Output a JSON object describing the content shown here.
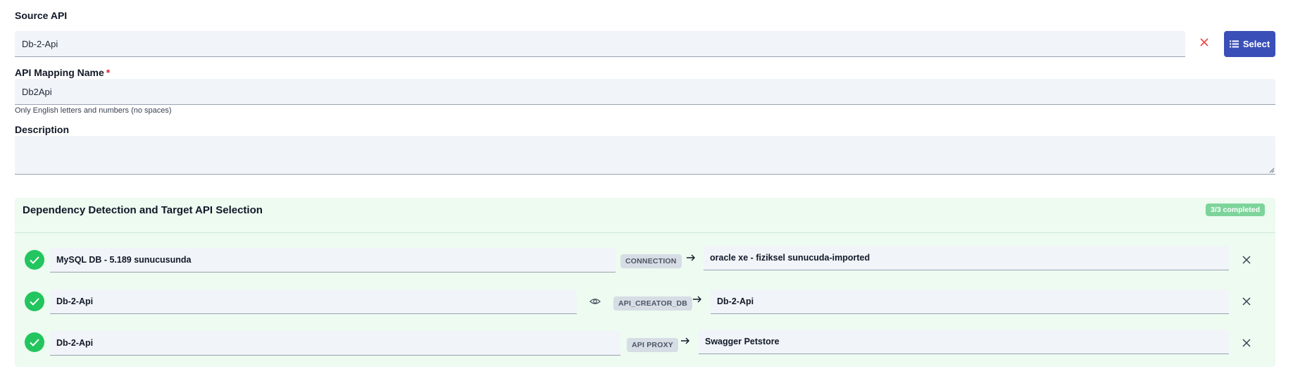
{
  "source_api": {
    "label": "Source API",
    "value": "Db-2-Api",
    "select_label": "Select"
  },
  "mapping_name": {
    "label": "API Mapping Name",
    "required_mark": "*",
    "value": "Db2Api",
    "hint": "Only English letters and numbers (no spaces)"
  },
  "description": {
    "label": "Description",
    "value": ""
  },
  "dependencies": {
    "title": "Dependency Detection and Target API Selection",
    "status_badge": "3/3 completed",
    "rows": [
      {
        "source": "MySQL DB - 5.189 sunucusunda",
        "type": "CONNECTION",
        "target": "oracle xe - fiziksel sunucuda-imported"
      },
      {
        "source": "Db-2-Api",
        "type": "API_CREATOR_DB",
        "target": "Db-2-Api"
      },
      {
        "source": "Db-2-Api",
        "type": "API PROXY",
        "target": "Swagger Petstore"
      }
    ]
  },
  "colors": {
    "accent": "#3b4fb8",
    "success": "#22c55e",
    "danger": "#ef4444",
    "panel_bg": "#edfbf1"
  }
}
